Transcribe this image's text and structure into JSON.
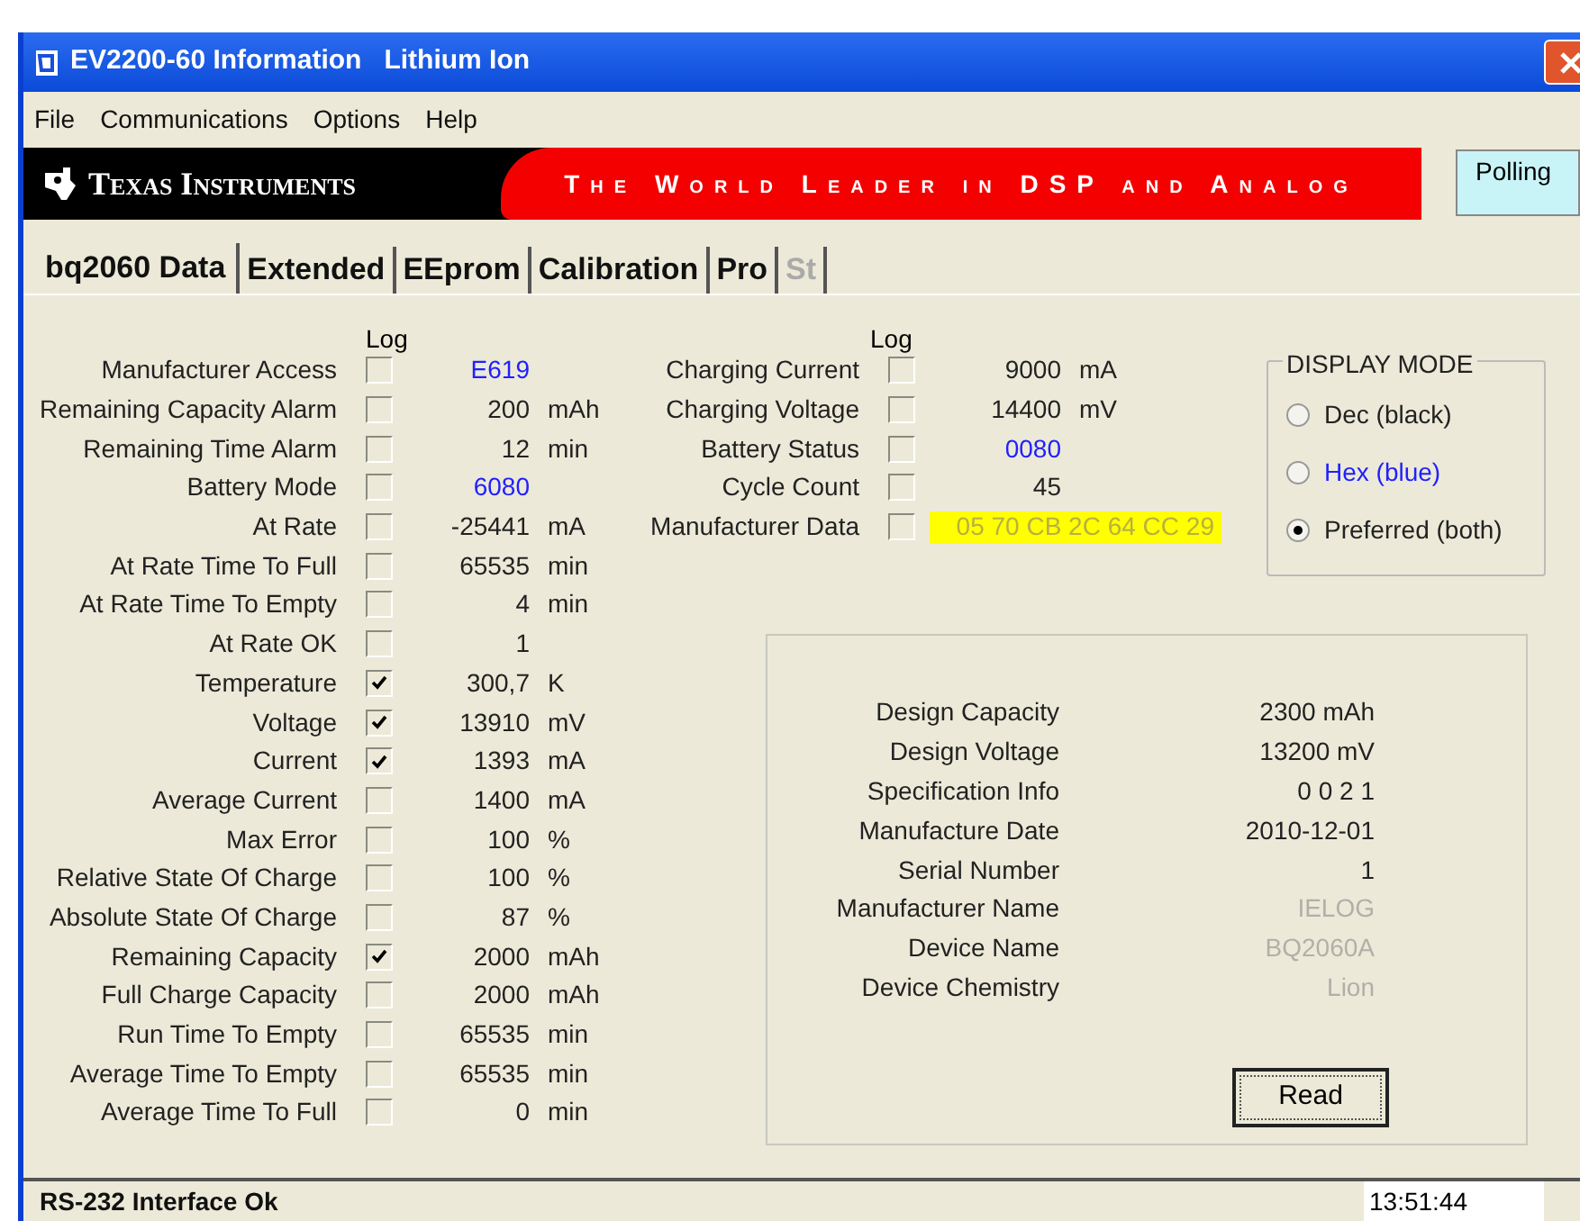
{
  "window": {
    "title": "EV2200-60 Information   Lithium Ion"
  },
  "menu": [
    "File",
    "Communications",
    "Options",
    "Help"
  ],
  "banner": {
    "logo": "Texas Instruments",
    "slogan": "The World Leader in DSP and Analog",
    "polling": "Polling"
  },
  "tabs": [
    {
      "label": "bq2060 Data",
      "selected": true,
      "disabled": false
    },
    {
      "label": "Extended",
      "selected": false,
      "disabled": false
    },
    {
      "label": "EEprom",
      "selected": false,
      "disabled": false
    },
    {
      "label": "Calibration",
      "selected": false,
      "disabled": false
    },
    {
      "label": "Pro",
      "selected": false,
      "disabled": false
    },
    {
      "label": "St",
      "selected": false,
      "disabled": true
    }
  ],
  "left_log_header": "Log",
  "left_rows": [
    {
      "label": "Manufacturer Access",
      "checked": false,
      "value": "E619",
      "kind": "hex"
    },
    {
      "label": "Remaining Capacity Alarm",
      "checked": false,
      "value": "200",
      "unit": "mAh",
      "kind": "dec"
    },
    {
      "label": "Remaining Time Alarm",
      "checked": false,
      "value": "12",
      "unit": "min",
      "kind": "dec"
    },
    {
      "label": "Battery Mode",
      "checked": false,
      "value": "6080",
      "kind": "hex"
    },
    {
      "label": "At Rate",
      "checked": false,
      "value": "-25441",
      "unit": "mA",
      "kind": "dec"
    },
    {
      "label": "At Rate Time To Full",
      "checked": false,
      "value": "65535",
      "unit": "min",
      "kind": "dec"
    },
    {
      "label": "At Rate Time To Empty",
      "checked": false,
      "value": "4",
      "unit": "min",
      "kind": "dec"
    },
    {
      "label": "At Rate OK",
      "checked": false,
      "value": "1",
      "kind": "dec"
    },
    {
      "label": "Temperature",
      "checked": true,
      "value": "300,7",
      "unit": "K",
      "kind": "dec"
    },
    {
      "label": "Voltage",
      "checked": true,
      "value": "13910",
      "unit": "mV",
      "kind": "dec"
    },
    {
      "label": "Current",
      "checked": true,
      "value": "1393",
      "unit": "mA",
      "kind": "dec"
    },
    {
      "label": "Average Current",
      "checked": false,
      "value": "1400",
      "unit": "mA",
      "kind": "dec"
    },
    {
      "label": "Max Error",
      "checked": false,
      "value": "100",
      "unit": "%",
      "kind": "dec"
    },
    {
      "label": "Relative State Of Charge",
      "checked": false,
      "value": "100",
      "unit": "%",
      "kind": "dec"
    },
    {
      "label": "Absolute State Of Charge",
      "checked": false,
      "value": "87",
      "unit": "%",
      "kind": "dec"
    },
    {
      "label": "Remaining Capacity",
      "checked": true,
      "value": "2000",
      "unit": "mAh",
      "kind": "dec"
    },
    {
      "label": "Full Charge Capacity",
      "checked": false,
      "value": "2000",
      "unit": "mAh",
      "kind": "dec"
    },
    {
      "label": "Run Time To Empty",
      "checked": false,
      "value": "65535",
      "unit": "min",
      "kind": "dec"
    },
    {
      "label": "Average Time To Empty",
      "checked": false,
      "value": "65535",
      "unit": "min",
      "kind": "dec"
    },
    {
      "label": "Average Time To Full",
      "checked": false,
      "value": "0",
      "unit": "min",
      "kind": "dec"
    }
  ],
  "right_log_header": "Log",
  "right_rows": [
    {
      "label": "Charging Current",
      "checked": false,
      "value": "9000",
      "unit": "mA",
      "kind": "dec"
    },
    {
      "label": "Charging Voltage",
      "checked": false,
      "value": "14400",
      "unit": "mV",
      "kind": "dec"
    },
    {
      "label": "Battery Status",
      "checked": false,
      "value": "0080",
      "kind": "hex"
    },
    {
      "label": "Cycle Count",
      "checked": false,
      "value": "45",
      "kind": "dec"
    },
    {
      "label": "Manufacturer Data",
      "checked": false,
      "value": "05 70 CB 2C 64 CC 29",
      "kind": "highlight"
    }
  ],
  "display_mode": {
    "title": "DISPLAY MODE",
    "options": [
      {
        "label": "Dec (black)",
        "selected": false,
        "kind": "dec"
      },
      {
        "label": "Hex (blue)",
        "selected": false,
        "kind": "hex"
      },
      {
        "label": "Preferred (both)",
        "selected": true,
        "kind": "dec"
      }
    ]
  },
  "design": {
    "rows": [
      {
        "label": "Design Capacity",
        "value": "2300 mAh",
        "disabled": false
      },
      {
        "label": "Design Voltage",
        "value": "13200 mV",
        "disabled": false
      },
      {
        "label": "Specification Info",
        "value": "0 0 2 1",
        "disabled": false
      },
      {
        "label": "Manufacture Date",
        "value": "2010-12-01",
        "disabled": false
      },
      {
        "label": "Serial Number",
        "value": "1",
        "disabled": false
      },
      {
        "label": "Manufacturer Name",
        "value": "IELOG",
        "disabled": true
      },
      {
        "label": "Device Name",
        "value": "BQ2060A",
        "disabled": true
      },
      {
        "label": "Device Chemistry",
        "value": "Lion",
        "disabled": true
      }
    ],
    "read_button": "Read"
  },
  "status_bar": {
    "message": "RS-232 Interface Ok",
    "time": "13:51:44"
  }
}
